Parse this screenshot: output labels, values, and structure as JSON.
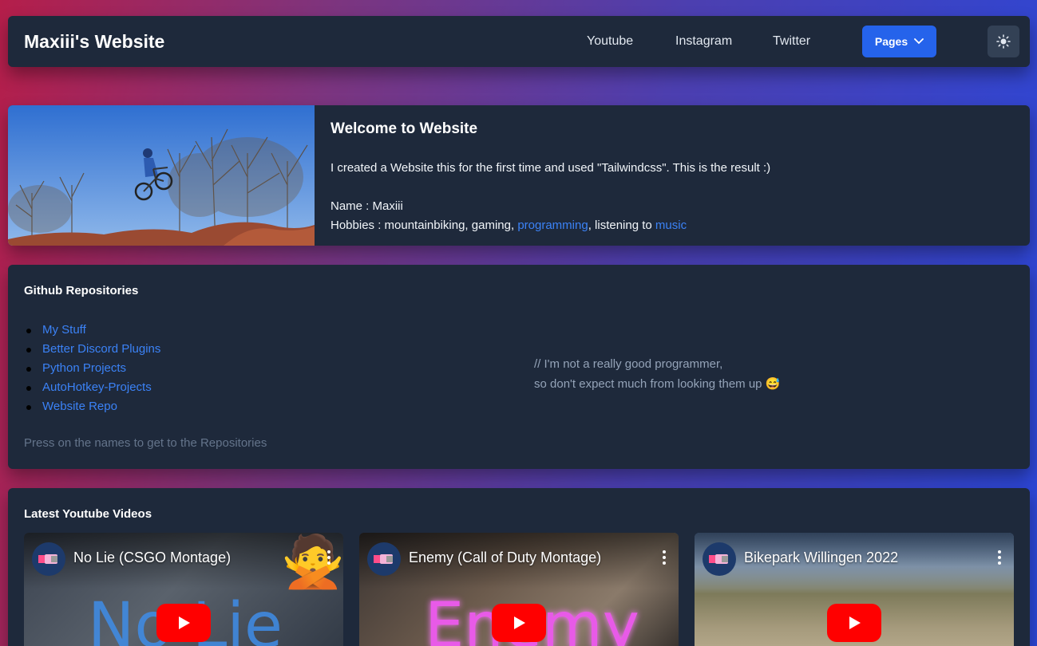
{
  "navbar": {
    "brand": "Maxiii's Website",
    "links": [
      "Youtube",
      "Instagram",
      "Twitter"
    ],
    "pages_label": "Pages"
  },
  "welcome": {
    "title": "Welcome to Website",
    "intro": "I created a Website this for the first time and used \"Tailwindcss\". This is the result :)",
    "name_line": "Name : Maxiii",
    "hobbies_prefix": "Hobbies : mountainbiking, gaming, ",
    "hobby_link_programming": "programming",
    "hobbies_middle": ", listening to ",
    "hobby_link_music": "music"
  },
  "github": {
    "title": "Github Repositories",
    "repos": [
      "My Stuff",
      "Better Discord Plugins",
      "Python Projects",
      "AutoHotkey-Projects",
      "Website Repo"
    ],
    "hint": "Press on the names to get to the Repositories",
    "comment_line1": "// I'm not a really good programmer,",
    "comment_line2": "so don't expect much from looking them up",
    "comment_emoji": "😅"
  },
  "videos": {
    "title": "Latest Youtube Videos",
    "items": [
      {
        "title": "No Lie (CSGO Montage)",
        "overlay_text": "No Lie",
        "overlay_emoji": "🙅"
      },
      {
        "title": "Enemy (Call of Duty Montage)",
        "overlay_text": "Enemy"
      },
      {
        "title": "Bikepark Willingen 2022"
      }
    ]
  },
  "colors": {
    "card": "#1e293b",
    "accent": "#2563eb",
    "link": "#3b82f6",
    "youtube_red": "#ff0000"
  }
}
